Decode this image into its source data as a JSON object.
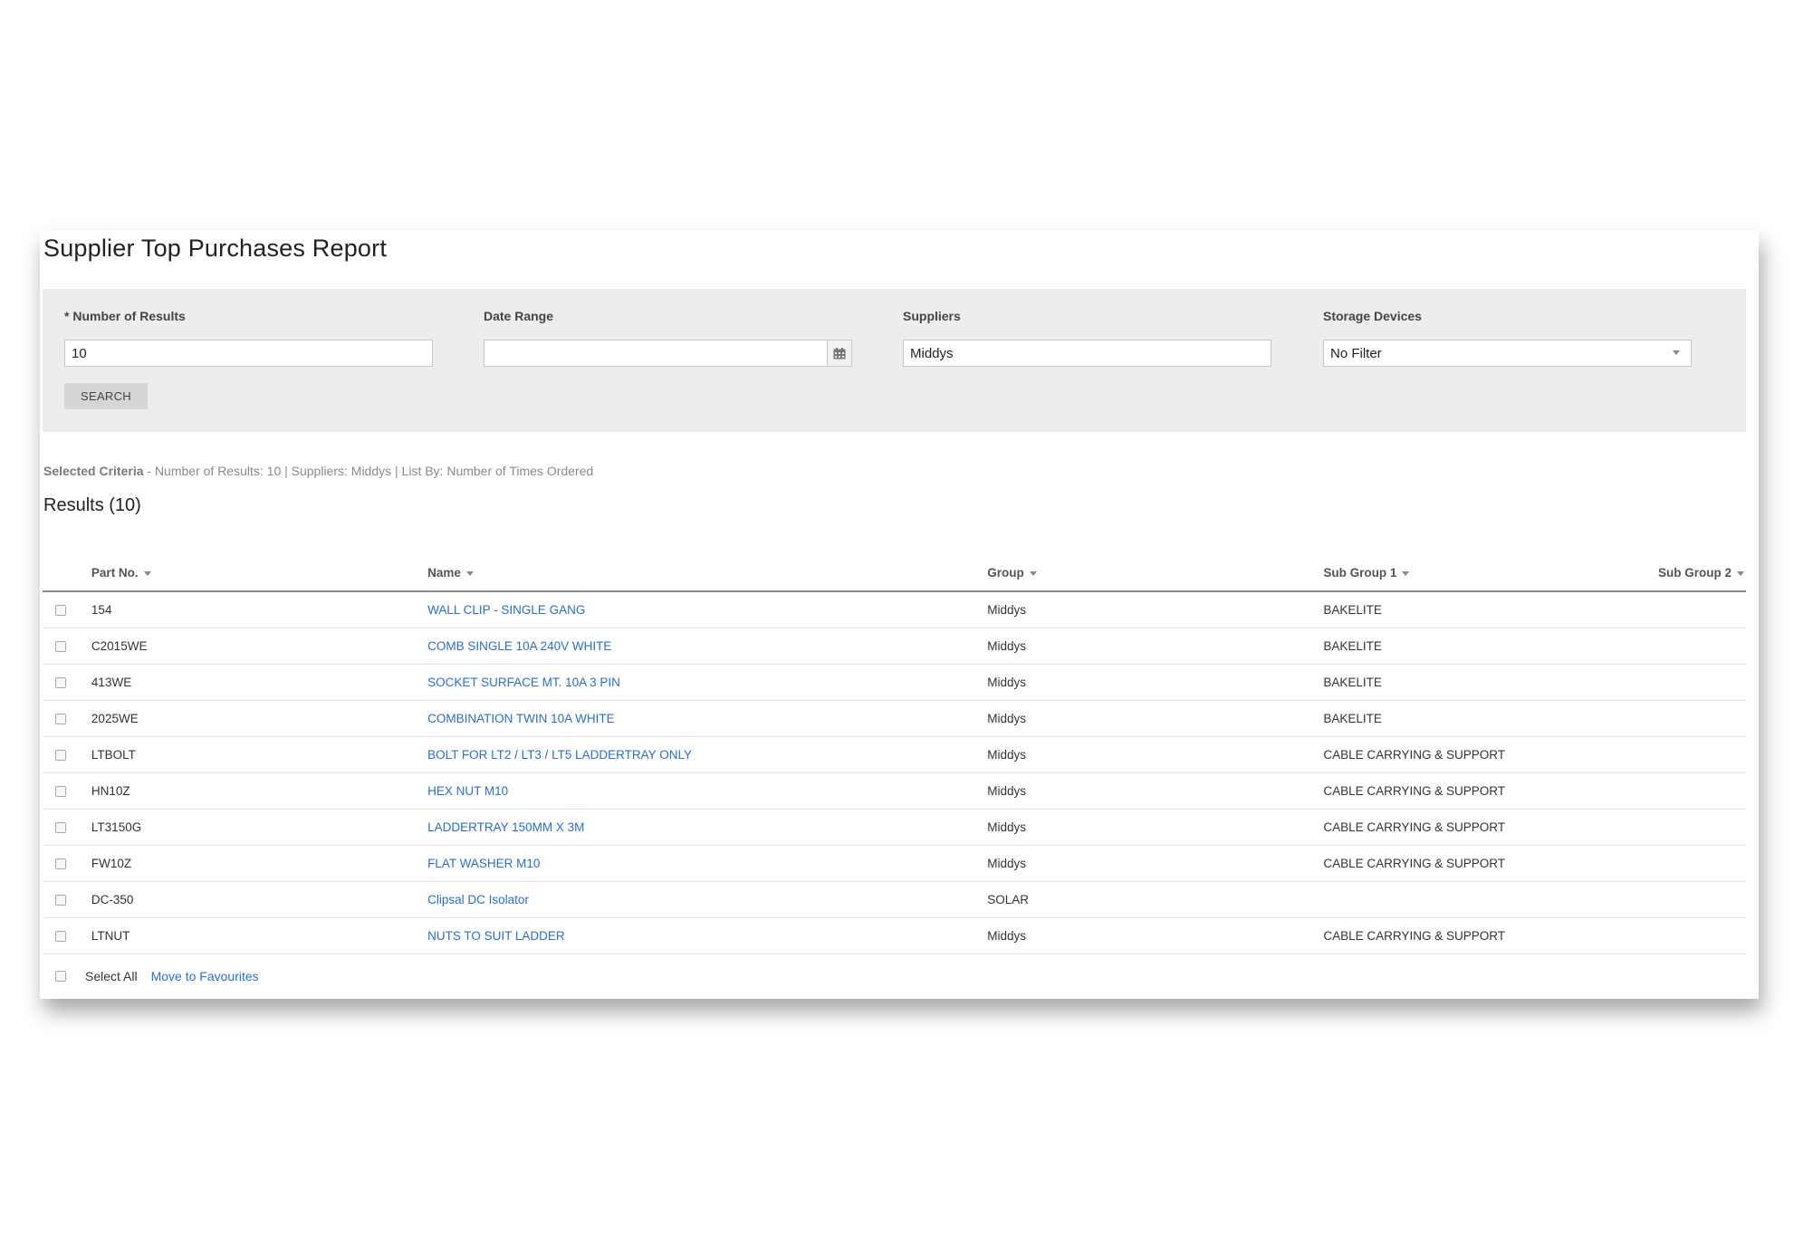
{
  "page": {
    "title": "Supplier Top Purchases Report"
  },
  "filters": {
    "number_of_results": {
      "label": "* Number of Results",
      "value": "10"
    },
    "date_range": {
      "label": "Date Range",
      "value": ""
    },
    "suppliers": {
      "label": "Suppliers",
      "value": "Middys"
    },
    "storage_devices": {
      "label": "Storage Devices",
      "value": "No Filter"
    },
    "search_label": "SEARCH"
  },
  "criteria": {
    "label": "Selected Criteria",
    "text": " - Number of Results: 10 | Suppliers: Middys | List By: Number of Times Ordered"
  },
  "results": {
    "title": "Results (10)",
    "columns": [
      "Part No.",
      "Name",
      "Group",
      "Sub Group 1",
      "Sub Group 2"
    ],
    "rows": [
      {
        "part": "154",
        "name": "WALL CLIP - SINGLE GANG",
        "group": "Middys",
        "sub1": "BAKELITE",
        "sub2": ""
      },
      {
        "part": "C2015WE",
        "name": "COMB SINGLE 10A 240V WHITE",
        "group": "Middys",
        "sub1": "BAKELITE",
        "sub2": ""
      },
      {
        "part": "413WE",
        "name": "SOCKET SURFACE MT. 10A 3 PIN",
        "group": "Middys",
        "sub1": "BAKELITE",
        "sub2": ""
      },
      {
        "part": "2025WE",
        "name": "COMBINATION TWIN 10A WHITE",
        "group": "Middys",
        "sub1": "BAKELITE",
        "sub2": ""
      },
      {
        "part": "LTBOLT",
        "name": "BOLT FOR LT2 / LT3 / LT5 LADDERTRAY ONLY",
        "group": "Middys",
        "sub1": "CABLE CARRYING & SUPPORT",
        "sub2": ""
      },
      {
        "part": "HN10Z",
        "name": "HEX NUT M10",
        "group": "Middys",
        "sub1": "CABLE CARRYING & SUPPORT",
        "sub2": ""
      },
      {
        "part": "LT3150G",
        "name": "LADDERTRAY 150MM X 3M",
        "group": "Middys",
        "sub1": "CABLE CARRYING & SUPPORT",
        "sub2": ""
      },
      {
        "part": "FW10Z",
        "name": "FLAT WASHER M10",
        "group": "Middys",
        "sub1": "CABLE CARRYING & SUPPORT",
        "sub2": ""
      },
      {
        "part": "DC-350",
        "name": "Clipsal DC Isolator",
        "group": "SOLAR",
        "sub1": "",
        "sub2": ""
      },
      {
        "part": "LTNUT",
        "name": "NUTS TO SUIT LADDER",
        "group": "Middys",
        "sub1": "CABLE CARRYING & SUPPORT",
        "sub2": ""
      }
    ]
  },
  "footer": {
    "select_all": "Select All",
    "move_to_favourites": "Move to Favourites"
  },
  "colors": {
    "link": "#2a6fc9",
    "filter_panel": "#ededed",
    "button": "#d4d6d8"
  }
}
